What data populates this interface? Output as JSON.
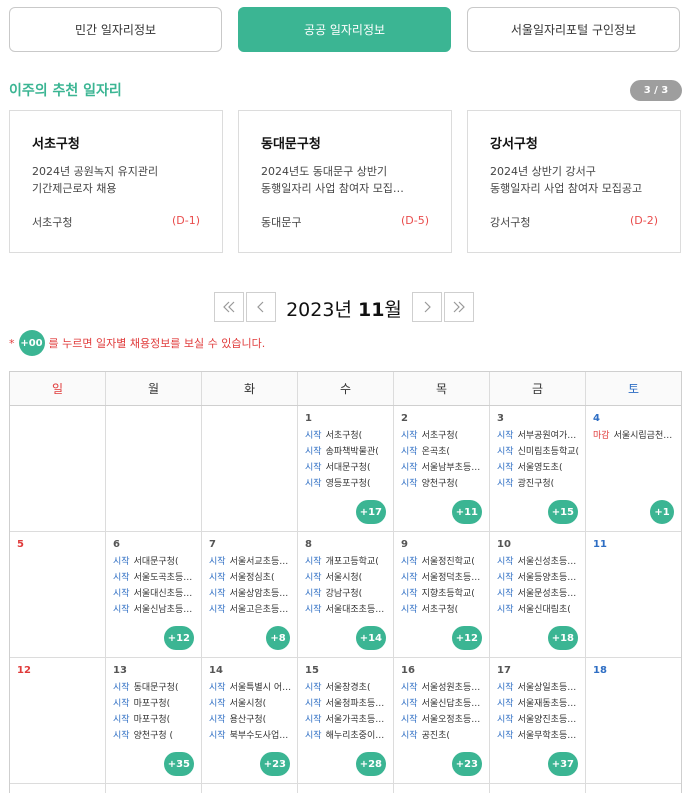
{
  "tabs": [
    {
      "label": "민간 일자리정보",
      "active": false
    },
    {
      "label": "공공 일자리정보",
      "active": true
    },
    {
      "label": "서울일자리포털 구인정보",
      "active": false
    }
  ],
  "recommend": {
    "title": "이주의 추천 일자리",
    "page": "3 / 3",
    "cards": [
      {
        "org": "서초구청",
        "desc1": "2024년 공원녹지 유지관리",
        "desc2": "기간제근로자 채용",
        "agency": "서초구청",
        "dday": "(D-1)"
      },
      {
        "org": "동대문구청",
        "desc1": "2024년도 동대문구 상반기",
        "desc2": "동행일자리 사업 참여자 모집…",
        "agency": "동대문구",
        "dday": "(D-5)"
      },
      {
        "org": "강서구청",
        "desc1": "2024년 상반기 강서구",
        "desc2": "동행일자리 사업 참여자 모집공고",
        "agency": "강서구청",
        "dday": "(D-2)"
      }
    ]
  },
  "calendar": {
    "year": "2023",
    "year_suffix": "년",
    "month": "11",
    "month_suffix": "월",
    "notice_star": "*",
    "notice_pill": "+00",
    "notice_text": "를 누르면 일자별 채용정보를 보실 수 있습니다.",
    "weekdays": [
      "일",
      "월",
      "화",
      "수",
      "목",
      "금",
      "토"
    ],
    "weeks": [
      [
        {
          "num": "",
          "items": [],
          "more": ""
        },
        {
          "num": "",
          "items": [],
          "more": ""
        },
        {
          "num": "",
          "items": [],
          "more": ""
        },
        {
          "num": "1",
          "items": [
            {
              "s": "시작",
              "n": "서초구청("
            },
            {
              "s": "시작",
              "n": "송파책박물관("
            },
            {
              "s": "시작",
              "n": "서대문구청("
            },
            {
              "s": "시작",
              "n": "영등포구청("
            }
          ],
          "more": "+17"
        },
        {
          "num": "2",
          "items": [
            {
              "s": "시작",
              "n": "서초구청("
            },
            {
              "s": "시작",
              "n": "온곡초("
            },
            {
              "s": "시작",
              "n": "서울남부초등…"
            },
            {
              "s": "시작",
              "n": "양천구청("
            }
          ],
          "more": "+11"
        },
        {
          "num": "3",
          "items": [
            {
              "s": "시작",
              "n": "서부공원여가…"
            },
            {
              "s": "시작",
              "n": "신미림초등학교("
            },
            {
              "s": "시작",
              "n": "서울영도초("
            },
            {
              "s": "시작",
              "n": "광진구청("
            }
          ],
          "more": "+15"
        },
        {
          "num": "4",
          "items": [
            {
              "s": "마감",
              "n": "서울시립금천…"
            }
          ],
          "more": "+1"
        }
      ],
      [
        {
          "num": "5",
          "items": [],
          "more": ""
        },
        {
          "num": "6",
          "items": [
            {
              "s": "시작",
              "n": "서대문구청("
            },
            {
              "s": "시작",
              "n": "서울도곡초등…"
            },
            {
              "s": "시작",
              "n": "서울대신초등…"
            },
            {
              "s": "시작",
              "n": "서울신남초등…"
            }
          ],
          "more": "+12"
        },
        {
          "num": "7",
          "items": [
            {
              "s": "시작",
              "n": "서울서교초등…"
            },
            {
              "s": "시작",
              "n": "서울정심초("
            },
            {
              "s": "시작",
              "n": "서울상암초등…"
            },
            {
              "s": "시작",
              "n": "서울고은초등…"
            }
          ],
          "more": "+8"
        },
        {
          "num": "8",
          "items": [
            {
              "s": "시작",
              "n": "개포고등학교("
            },
            {
              "s": "시작",
              "n": "서울시청("
            },
            {
              "s": "시작",
              "n": "강남구청("
            },
            {
              "s": "시작",
              "n": "서울대조초등…"
            }
          ],
          "more": "+14"
        },
        {
          "num": "9",
          "items": [
            {
              "s": "시작",
              "n": "서울정진학교("
            },
            {
              "s": "시작",
              "n": "서울정덕초등…"
            },
            {
              "s": "시작",
              "n": "지향초등학교("
            },
            {
              "s": "시작",
              "n": "서초구청("
            }
          ],
          "more": "+12"
        },
        {
          "num": "10",
          "items": [
            {
              "s": "시작",
              "n": "서울신성초등…"
            },
            {
              "s": "시작",
              "n": "서울등양초등…"
            },
            {
              "s": "시작",
              "n": "서울문성초등…"
            },
            {
              "s": "시작",
              "n": "서울신대림초("
            }
          ],
          "more": "+18"
        },
        {
          "num": "11",
          "items": [],
          "more": ""
        }
      ],
      [
        {
          "num": "12",
          "items": [],
          "more": ""
        },
        {
          "num": "13",
          "items": [
            {
              "s": "시작",
              "n": "동대문구청("
            },
            {
              "s": "시작",
              "n": "마포구청("
            },
            {
              "s": "시작",
              "n": "마포구청("
            },
            {
              "s": "시작",
              "n": "양천구청 ("
            }
          ],
          "more": "+35"
        },
        {
          "num": "14",
          "items": [
            {
              "s": "시작",
              "n": "서울특별시 어…"
            },
            {
              "s": "시작",
              "n": "서울시청("
            },
            {
              "s": "시작",
              "n": "용산구청("
            },
            {
              "s": "시작",
              "n": "북부수도사업소 ("
            }
          ],
          "more": "+23"
        },
        {
          "num": "15",
          "items": [
            {
              "s": "시작",
              "n": "서울창경초("
            },
            {
              "s": "시작",
              "n": "서울청파초등…"
            },
            {
              "s": "시작",
              "n": "서울가곡초등…"
            },
            {
              "s": "시작",
              "n": "해누리초중이…"
            }
          ],
          "more": "+28"
        },
        {
          "num": "16",
          "items": [
            {
              "s": "시작",
              "n": "서울성원초등…"
            },
            {
              "s": "시작",
              "n": "서울신답초등…"
            },
            {
              "s": "시작",
              "n": "서울오정초등…"
            },
            {
              "s": "시작",
              "n": "공진초("
            }
          ],
          "more": "+23"
        },
        {
          "num": "17",
          "items": [
            {
              "s": "시작",
              "n": "서울상일초등…"
            },
            {
              "s": "시작",
              "n": "서울재동초등…"
            },
            {
              "s": "시작",
              "n": "서울양진초등…"
            },
            {
              "s": "시작",
              "n": "서울무학초등…"
            }
          ],
          "more": "+37"
        },
        {
          "num": "18",
          "items": [],
          "more": ""
        }
      ]
    ]
  }
}
